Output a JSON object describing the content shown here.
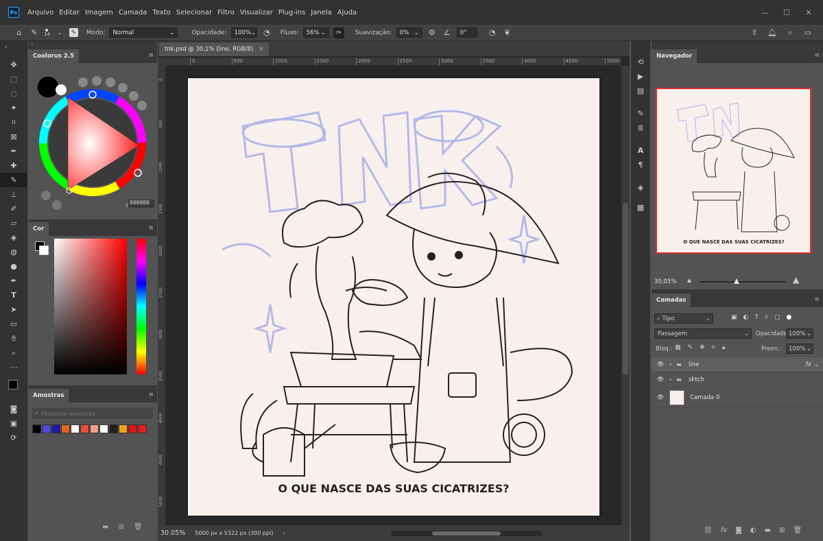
{
  "app": {
    "logo": "Ps",
    "menus": [
      "Arquivo",
      "Editar",
      "Imagem",
      "Camada",
      "Texto",
      "Selecionar",
      "Filtro",
      "Visualizar",
      "Plug-ins",
      "Janela",
      "Ajuda"
    ]
  },
  "options_bar": {
    "brush_size": "14",
    "mode_label": "Modo:",
    "mode_value": "Normal",
    "opacity_label": "Opacidade:",
    "opacity_value": "100%",
    "flow_label": "Fluxo:",
    "flow_value": "56%",
    "smoothing_label": "Suavização:",
    "smoothing_value": "0%",
    "angle_value": "0°"
  },
  "coolorus": {
    "tab": "Coolorus 2.5",
    "hex": "000000"
  },
  "color_panel": {
    "tab": "Cor"
  },
  "swatches": {
    "tab": "Amostras",
    "search_placeholder": "Pesquisar amostras",
    "colors": [
      "#000000",
      "#4a4ad8",
      "#1a1aa8",
      "#e8641e",
      "#ffffff",
      "#e8523a",
      "#f4a088",
      "#ffffff",
      "#202020",
      "#f0a020",
      "#d81818",
      "#e02020"
    ]
  },
  "document": {
    "tab": "tnk.psd @ 30,1% (line, RGB/8)",
    "ruler_ticks": [
      "0",
      "500",
      "1000",
      "1500",
      "2000",
      "2500",
      "3000",
      "3500",
      "4000",
      "4500",
      "5000"
    ],
    "vruler_ticks": [
      "0",
      "500",
      "1000",
      "1500",
      "2000",
      "2500",
      "3000",
      "3500",
      "4000",
      "4500",
      "5000"
    ],
    "zoom": "30.05%",
    "dimensions": "5000 px x 5322 px (300 ppi)",
    "art_caption": "O QUE NASCE DAS SUAS CICATRIZES?"
  },
  "navigator": {
    "tab": "Navegador",
    "zoom": "30,05%",
    "caption": "O QUE NASCE DAS SUAS CICATRIZES?"
  },
  "layers": {
    "tab": "Camadas",
    "filter_value": "Tipo",
    "blend_mode": "Passagem",
    "opacity_label": "Opacidade:",
    "opacity_value": "100%",
    "lock_label": "Bloq.:",
    "fill_label": "Preen.:",
    "fill_value": "100%",
    "rows": [
      {
        "name": "line",
        "fx": "fx"
      },
      {
        "name": "sktch"
      },
      {
        "name": "Camada 0"
      }
    ]
  },
  "colors": {
    "accent_red": "#e03030",
    "ui_dark": "#323232",
    "ui_mid": "#535353",
    "paper": "#f8f0ed"
  }
}
